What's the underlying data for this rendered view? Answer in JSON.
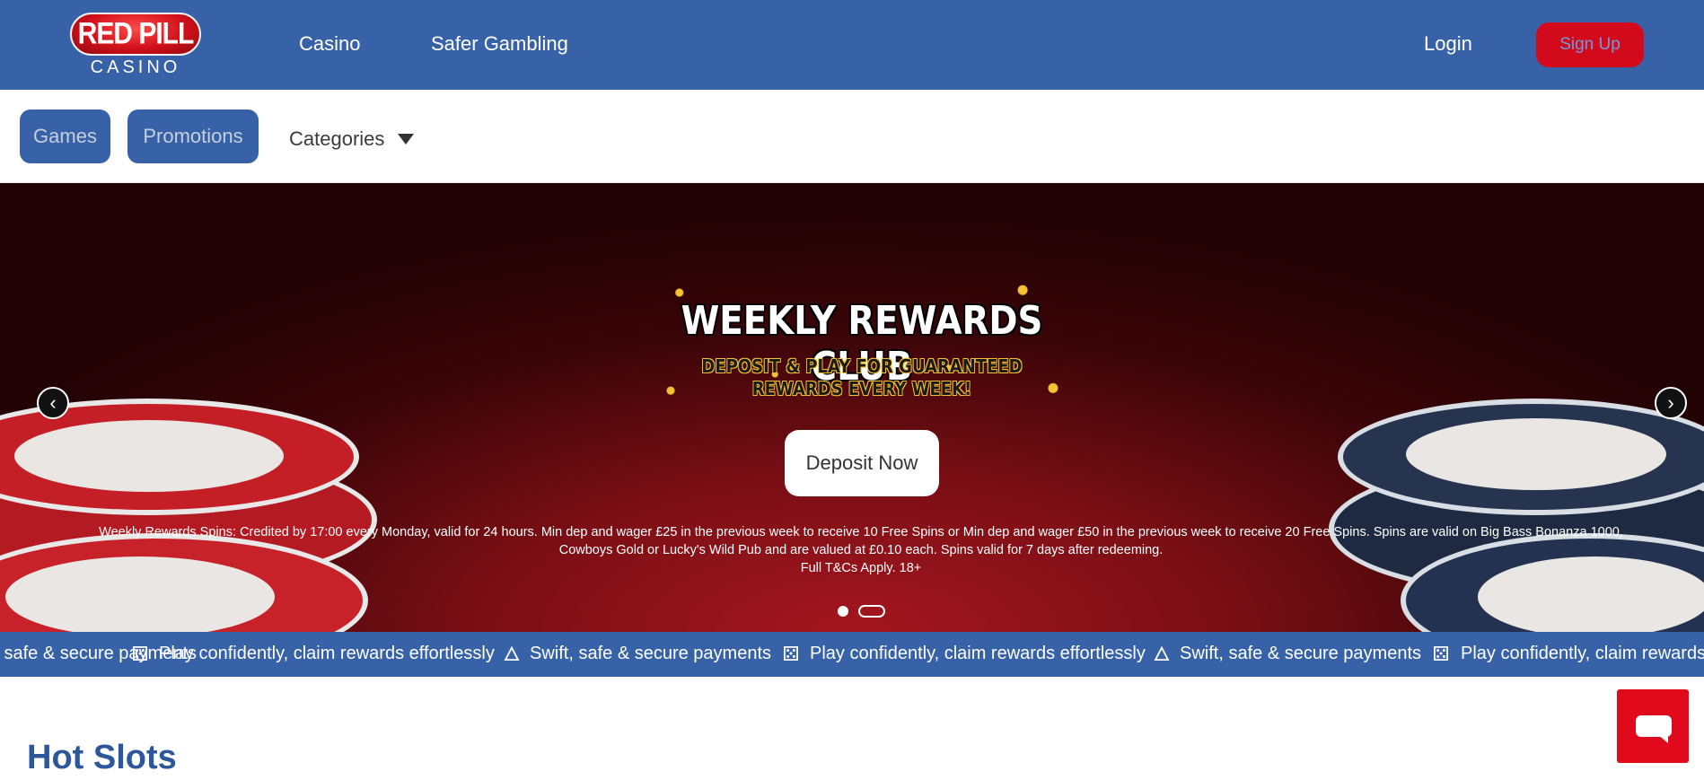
{
  "header": {
    "logo_text": "RED PILL",
    "logo_sub": "CASINO",
    "nav": [
      {
        "label": "Casino"
      },
      {
        "label": "Safer Gambling"
      }
    ],
    "login_label": "Login",
    "signup_label": "Sign Up"
  },
  "subnav": {
    "games_label": "Games",
    "promotions_label": "Promotions",
    "categories_label": "Categories"
  },
  "hero": {
    "promo_title": "WEEKLY REWARDS CLUB",
    "promo_sub_line1": "DEPOSIT & PLAY FOR GUARANTEED",
    "promo_sub_line2": "REWARDS EVERY WEEK!",
    "cta_label": "Deposit Now",
    "terms_line1": "Weekly Rewards Spins: Credited by 17:00 every Monday, valid for 24 hours. Min dep and wager £25 in the previous week to receive 10 Free Spins or Min dep and wager £50 in the previous week to receive 20 Free Spins. Spins are valid on Big Bass Bonanza 1000,",
    "terms_line2": "Cowboys Gold or Lucky's Wild Pub and are valued at £0.10 each. Spins valid for 7 days after redeeming.",
    "terms_line3": "Full T&Cs Apply. 18+",
    "prev_icon": "‹",
    "next_icon": "›",
    "slides_total": 2,
    "active_slide": 2
  },
  "ticker": {
    "items": [
      {
        "icon": "flame-icon",
        "text": "Swift, safe & secure payments"
      },
      {
        "icon": "dice-icon",
        "text": "Play confidently, claim rewards effortlessly"
      },
      {
        "icon": "flame-icon",
        "text": "Swift, safe & secure payments"
      },
      {
        "icon": "dice-icon",
        "text": "Play confidently, claim rewards effortlessly"
      },
      {
        "icon": "flame-icon",
        "text": "Swift, safe & secure payments"
      },
      {
        "icon": "dice-icon",
        "text": "Play confidently, claim rewards effortlessly"
      }
    ]
  },
  "section": {
    "hot_slots_title": "Hot Slots"
  },
  "colors": {
    "brand_blue": "#3862a8",
    "brand_red": "#d30a1b"
  }
}
